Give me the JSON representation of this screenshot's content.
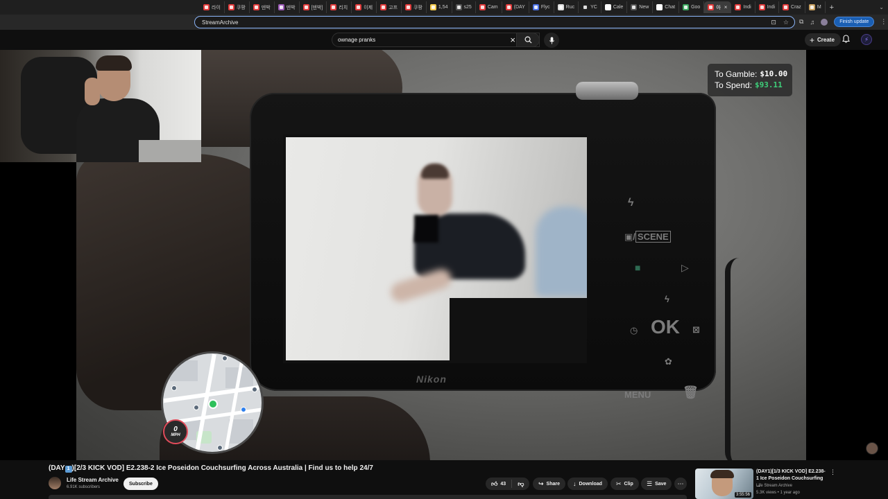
{
  "browser": {
    "tabs": [
      {
        "label": "라이",
        "color": "#e23b3b"
      },
      {
        "label": "쿠팡",
        "color": "#e23b3b"
      },
      {
        "label": "덴박",
        "color": "#e23b3b"
      },
      {
        "label": "덴박",
        "color": "#9b59b6"
      },
      {
        "label": "[덴박]",
        "color": "#e23b3b"
      },
      {
        "label": "리치",
        "color": "#e23b3b"
      },
      {
        "label": "이제",
        "color": "#e23b3b"
      },
      {
        "label": "고프",
        "color": "#e23b3b"
      },
      {
        "label": "쿠팡",
        "color": "#e23b3b"
      },
      {
        "label": "1,54",
        "color": "#f2c94c"
      },
      {
        "label": "s25",
        "color": "#555555"
      },
      {
        "label": "Cam",
        "color": "#e23b3b"
      },
      {
        "label": "(DAY",
        "color": "#e23b3b"
      },
      {
        "label": "Flyc",
        "color": "#4a6fe3"
      },
      {
        "label": "Ruc",
        "color": "#dddddd"
      },
      {
        "label": "YC",
        "color": "#222222"
      },
      {
        "label": "Cale",
        "color": "#ffffff"
      },
      {
        "label": "New",
        "color": "#555555"
      },
      {
        "label": "Chat",
        "color": "#ffffff"
      },
      {
        "label": "Goo",
        "color": "#3ba55d"
      },
      {
        "label": "아",
        "color": "#e23b3b",
        "active": true
      },
      {
        "label": "Indi",
        "color": "#e23b3b"
      },
      {
        "label": "Indi",
        "color": "#e23b3b"
      },
      {
        "label": "Craz",
        "color": "#e23b3b"
      },
      {
        "label": "M",
        "color": "#c8a060"
      }
    ],
    "address": "StreamArchive",
    "finish_update": "Finish update"
  },
  "masthead": {
    "search_query": "ownage pranks",
    "create_label": "Create"
  },
  "overlay": {
    "gamble_label": "To Gamble:",
    "gamble_value": "$10.00",
    "spend_label": "To Spend:",
    "spend_value": "$93.11",
    "speed_value": "0",
    "speed_unit": "MPH"
  },
  "camera": {
    "scene_label": "SCENE",
    "ok_label": "OK",
    "menu_label": "MENU",
    "brand": "Nikon"
  },
  "video": {
    "title_prefix": "(DAY",
    "title_badge": "1",
    "title_rest": ")[2/3 KICK VOD] E2.238-2 Ice Poseidon Couchsurfing Across Australia | Find us to help 24/7",
    "channel": "Life Stream Archive",
    "subscribers": "6.91K subscribers",
    "subscribe_label": "Subscribe",
    "likes": "43",
    "share_label": "Share",
    "download_label": "Download",
    "clip_label": "Clip",
    "save_label": "Save"
  },
  "related": {
    "title": "(DAY1)[1/3 KICK VOD] E2.238-1 Ice Poseidon Couchsurfing ...",
    "channel": "Life Stream Archive",
    "meta": "5.3K views • 1 year ago",
    "duration": "3:55:56"
  }
}
